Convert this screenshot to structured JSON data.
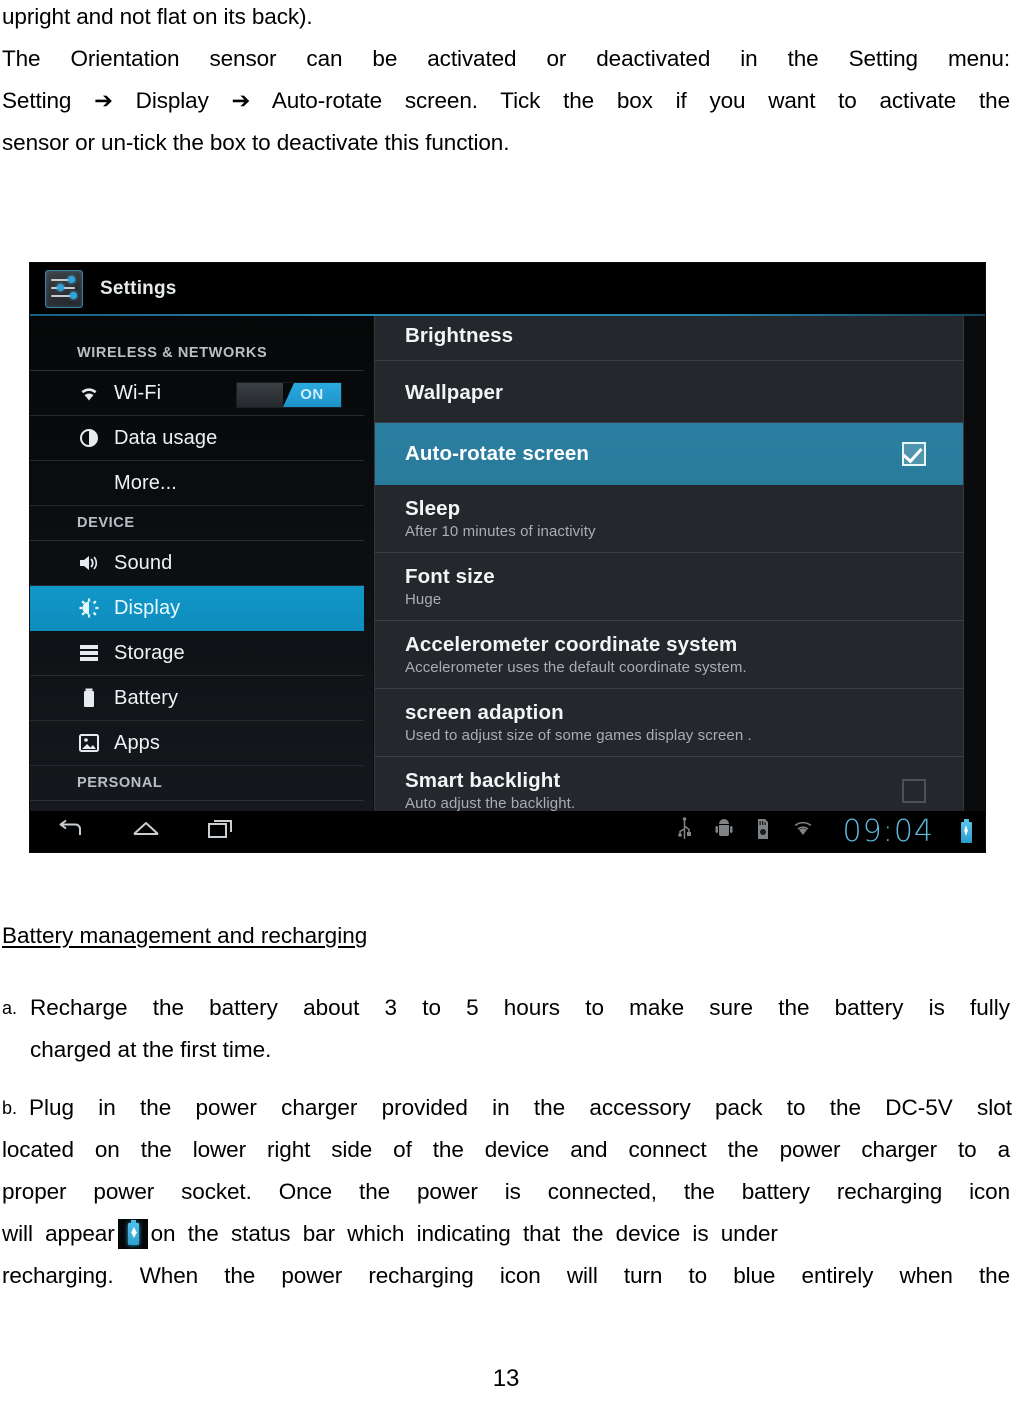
{
  "document": {
    "intro_lines": [
      "upright and not flat on its back).",
      "The Orientation sensor can be activated or deactivated in the Setting menu:",
      "Setting ➔ Display ➔ Auto-rotate screen.   Tick the box if you want to activate the",
      "sensor or un-tick the box to deactivate this function."
    ],
    "section_heading": "Battery management and recharging",
    "list": [
      {
        "marker": "a.",
        "lines": [
          "Recharge the battery about 3 to 5 hours to make sure the battery is fully",
          "charged at the first time."
        ]
      },
      {
        "marker": "b.",
        "lines": [
          "Plug in the power charger provided in the accessory pack to the DC-5V slot",
          "located on the lower right side of the device and connect the power charger to a",
          "proper power socket.   Once the power is connected, the battery recharging icon",
          "will  appear",
          "on  the  status  bar  which  indicating  that  the  device  is  under",
          "recharging.   When the power recharging icon will turn to blue entirely when the"
        ]
      }
    ],
    "page_number": "13"
  },
  "screenshot": {
    "title": "Settings",
    "app_icon": "settings-sliders-icon",
    "sidebar": {
      "groups": [
        {
          "header": "WIRELESS & NETWORKS",
          "items": [
            {
              "label": "Wi-Fi",
              "icon": "wifi-icon",
              "toggle": "ON",
              "selected": false
            },
            {
              "label": "Data usage",
              "icon": "data-usage-icon",
              "selected": false
            },
            {
              "label": "More...",
              "icon": "",
              "selected": false
            }
          ]
        },
        {
          "header": "DEVICE",
          "items": [
            {
              "label": "Sound",
              "icon": "speaker-icon",
              "selected": false
            },
            {
              "label": "Display",
              "icon": "brightness-icon",
              "selected": true
            },
            {
              "label": "Storage",
              "icon": "storage-list-icon",
              "selected": false
            },
            {
              "label": "Battery",
              "icon": "battery-icon",
              "selected": false
            },
            {
              "label": "Apps",
              "icon": "apps-image-icon",
              "selected": false
            }
          ]
        },
        {
          "header": "PERSONAL",
          "items": []
        }
      ]
    },
    "display_settings": [
      {
        "title": "Brightness",
        "subtitle": "",
        "control": "none",
        "highlight": false
      },
      {
        "title": "Wallpaper",
        "subtitle": "",
        "control": "none",
        "highlight": false
      },
      {
        "title": "Auto-rotate screen",
        "subtitle": "",
        "control": "checkbox-checked",
        "highlight": true
      },
      {
        "title": "Sleep",
        "subtitle": "After 10 minutes of inactivity",
        "control": "none",
        "highlight": false
      },
      {
        "title": "Font size",
        "subtitle": "Huge",
        "control": "none",
        "highlight": false
      },
      {
        "title": "Accelerometer coordinate system",
        "subtitle": "Accelerometer uses the default coordinate system.",
        "control": "none",
        "highlight": false
      },
      {
        "title": "screen adaption",
        "subtitle": "Used to adjust size of some games display screen .",
        "control": "none",
        "highlight": false
      },
      {
        "title": "Smart backlight",
        "subtitle": "Auto adjust the backlight.",
        "control": "checkbox-unchecked",
        "highlight": false
      }
    ],
    "navbar": {
      "back": "back-icon",
      "home": "home-icon",
      "recents": "recent-apps-icon",
      "status_icons": [
        "usb-icon",
        "android-debug-icon",
        "sd-card-icon",
        "wifi-status-icon"
      ],
      "clock": "09:04",
      "battery": "battery-charging-icon"
    },
    "colors": {
      "accent_blue": "#1197c9",
      "highlight_row": "#2b7fa0",
      "toggle_on": "#2cabe0",
      "clock": "#5fb9dd",
      "panel_bg": "#24272b",
      "sidebar_bg": "#0d1013"
    }
  }
}
